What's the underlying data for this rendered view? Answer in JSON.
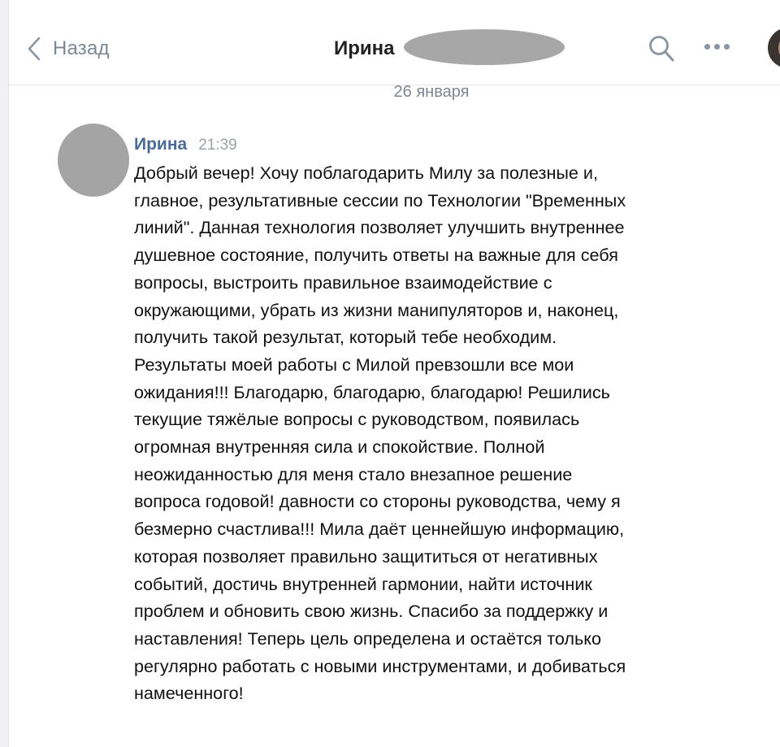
{
  "header": {
    "back_label": "Назад",
    "chat_name": "Ирина"
  },
  "date_separator": "26 января",
  "message": {
    "author": "Ирина",
    "time": "21:39",
    "lines": [
      "Добрый вечер! Хочу поблагодарить Милу за полезные и,",
      "главное, результативные сессии по Технологии \"Временных",
      "линий\". Данная технология позволяет улучшить внутреннее",
      "душевное состояние, получить ответы на важные для себя",
      "вопросы, выстроить правильное взаимодействие с",
      "окружающими, убрать из жизни манипуляторов и, наконец,",
      "получить такой результат, который тебе необходим.",
      "Результаты моей работы с Милой превзошли все мои",
      "ожидания!!! Благодарю, благодарю, благодарю! Решились",
      "текущие тяжёлые вопросы с руководством, появилась",
      "огромная внутренняя сила и спокойствие. Полной",
      "неожиданностью для меня стало внезапное решение",
      "вопроса годовой! давности со стороны руководства, чему я",
      "безмерно счастлива!!! Мила даёт ценнейшую информацию,",
      "которая позволяет правильно защититься от негативных",
      "событий, достичь внутренней гармонии, найти источник",
      "проблем и обновить свою жизнь. Спасибо за поддержку и",
      "наставления! Теперь цель определена и остаётся только",
      "регулярно работать с новыми инструментами, и добиваться",
      "намеченного!"
    ]
  },
  "icons": {
    "back": "chevron-left-icon",
    "search": "search-icon",
    "more": "more-horizontal-icon"
  },
  "colors": {
    "link": "#4a6b93",
    "muted": "#7c8794"
  }
}
